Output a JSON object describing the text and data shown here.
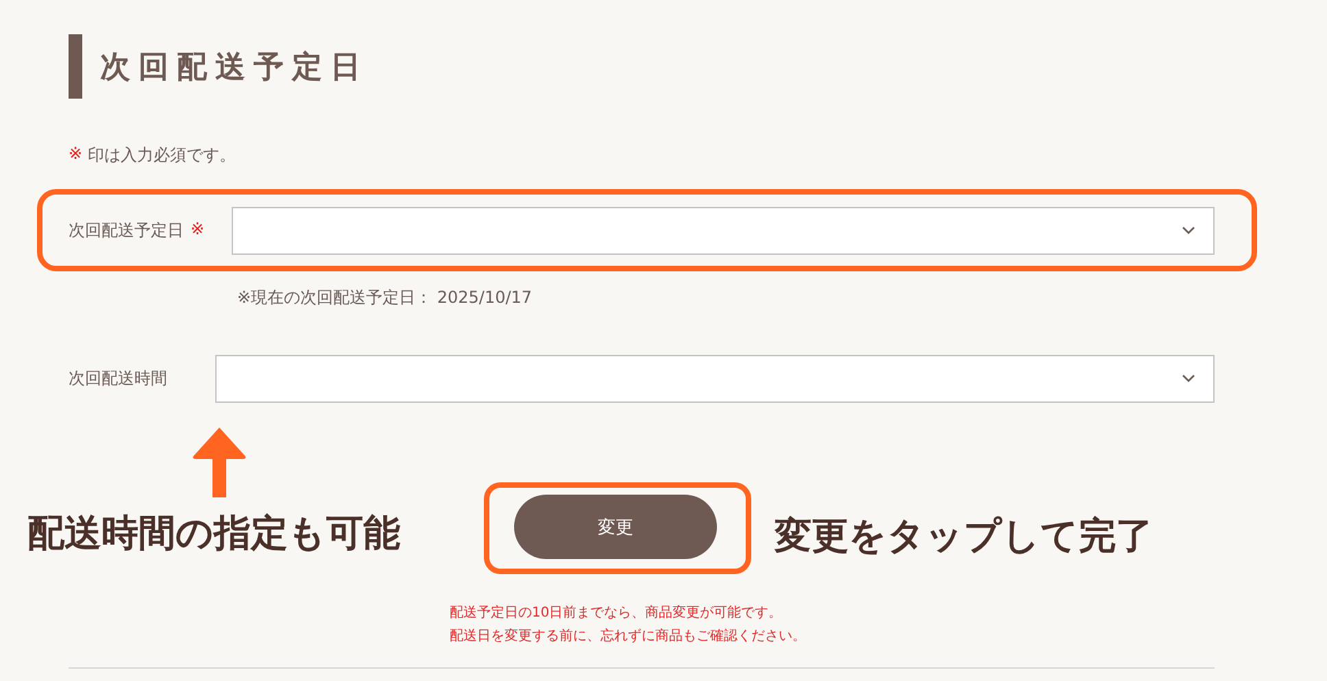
{
  "heading": {
    "title": "次回配送予定日"
  },
  "required_note": {
    "mark": "※",
    "text": "印は入力必須です。"
  },
  "fields": [
    {
      "label": "次回配送予定日",
      "required_mark": "※",
      "highlighted": true,
      "note": "※現在の次回配送予定日： 2025/10/17"
    },
    {
      "label": "次回配送時間",
      "highlighted": false
    }
  ],
  "annotations": [
    {
      "kind": "arrow-caption",
      "text": "配送時間の指定も可能"
    },
    {
      "kind": "caption",
      "text": "変更をタップして完了"
    }
  ],
  "submit_button": {
    "label": "変更",
    "highlighted": true
  },
  "notices": [
    "配送予定日の10日前までなら、商品変更が可能です。",
    "配送日を変更する前に、忘れずに商品もご確認ください。"
  ]
}
